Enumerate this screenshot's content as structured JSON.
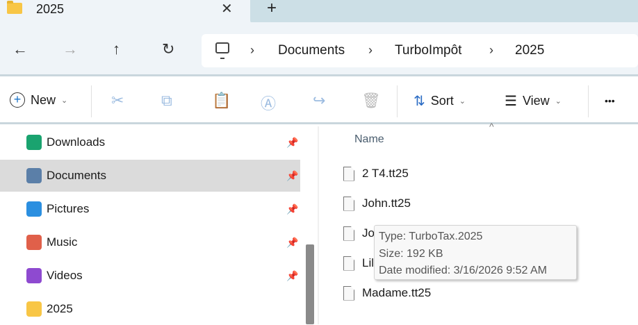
{
  "tab": {
    "title": "2025",
    "close": "✕",
    "new_tab": "+"
  },
  "nav": {
    "back": "←",
    "forward": "→",
    "up": "↑",
    "refresh": "↻"
  },
  "breadcrumb": [
    "Documents",
    "TurboImpôt",
    "2025"
  ],
  "toolbar": {
    "new_label": "New",
    "sort_label": "Sort",
    "view_label": "View",
    "more": "•••"
  },
  "sidebar": [
    {
      "label": "Downloads",
      "icon": "download-icon",
      "color": "#1aa36f"
    },
    {
      "label": "Documents",
      "icon": "documents-icon",
      "color": "#5b7fa8",
      "selected": true
    },
    {
      "label": "Pictures",
      "icon": "pictures-icon",
      "color": "#2b8fe0"
    },
    {
      "label": "Music",
      "icon": "music-icon",
      "color": "#e0604a"
    },
    {
      "label": "Videos",
      "icon": "videos-icon",
      "color": "#8e4ad0"
    },
    {
      "label": "2025",
      "icon": "folder-icon",
      "color": "#f8c646"
    }
  ],
  "list": {
    "header": "Name",
    "files": [
      "2 T4.tt25",
      "John.tt25",
      "Jo",
      "Lil",
      "Madame.tt25"
    ]
  },
  "tooltip": {
    "type": "Type: TurboTax.2025",
    "size": "Size: 192 KB",
    "date": "Date modified: 3/16/2026 9:52 AM"
  }
}
